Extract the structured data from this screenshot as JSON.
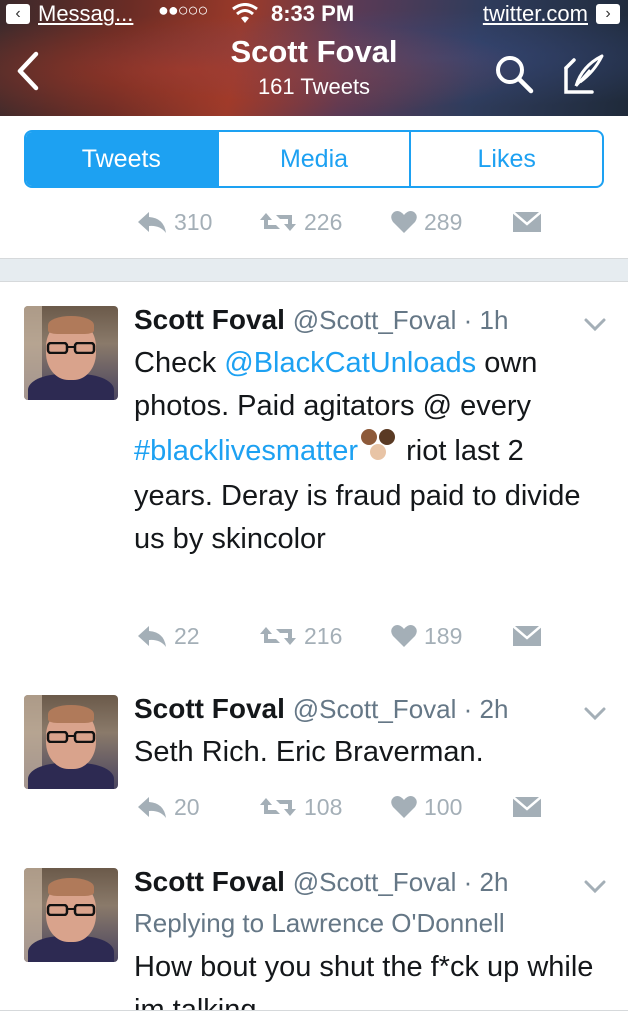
{
  "status_bar": {
    "back_app": "Messag...",
    "signal": "●●○○○",
    "time": "8:33 PM",
    "domain": "twitter.com"
  },
  "nav": {
    "title": "Scott Foval",
    "subtitle": "161 Tweets"
  },
  "tabs": [
    {
      "label": "Tweets",
      "active": true
    },
    {
      "label": "Media",
      "active": false
    },
    {
      "label": "Likes",
      "active": false
    }
  ],
  "partial_tweet": {
    "replies": "310",
    "retweets": "226",
    "likes": "289"
  },
  "tweets": [
    {
      "name": "Scott Foval",
      "handle": "@Scott_Foval",
      "time": "1h",
      "text_parts": [
        {
          "text": "Check ",
          "link": false
        },
        {
          "text": "@BlackCatUnloads",
          "link": true
        },
        {
          "text": " own photos. Paid agitators @ every ",
          "link": false
        },
        {
          "text": "#blacklivesmatter",
          "link": true
        },
        {
          "text": " riot last 2 years. Deray is fraud paid to divide us by skincolor",
          "link": false
        }
      ],
      "replies": "22",
      "retweets": "216",
      "likes": "189"
    },
    {
      "name": "Scott Foval",
      "handle": "@Scott_Foval",
      "time": "2h",
      "text": "Seth Rich. Eric Braverman.",
      "replies": "20",
      "retweets": "108",
      "likes": "100"
    },
    {
      "name": "Scott Foval",
      "handle": "@Scott_Foval",
      "time": "2h",
      "reply_prefix": "Replying to",
      "reply_to": "Lawrence O'Donnell",
      "text": "How bout you shut the f*ck up while im talking"
    }
  ],
  "colors": {
    "accent": "#1da1f2",
    "muted": "#a4afb7",
    "secondary_text": "#657786"
  }
}
